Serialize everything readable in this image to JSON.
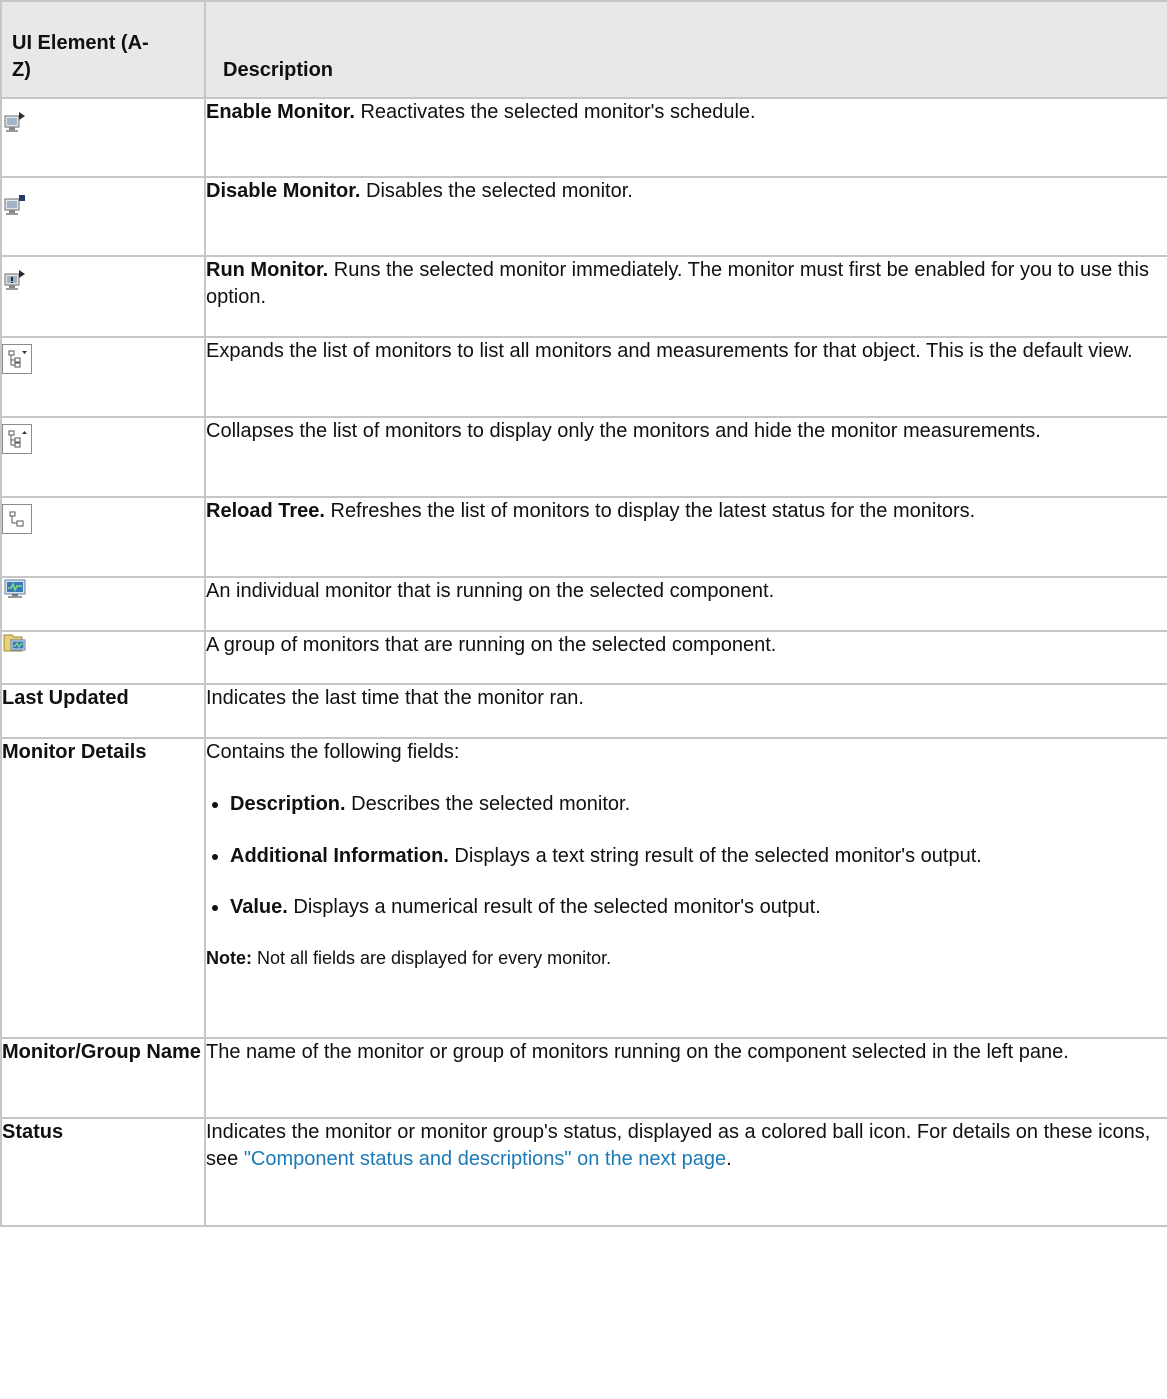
{
  "header": {
    "col1": "UI Element (A-Z)",
    "col2": "Description"
  },
  "rows": [
    {
      "icon": "enable-monitor-icon",
      "term": "Enable Monitor.",
      "text": " Reactivates the selected monitor's schedule."
    },
    {
      "icon": "disable-monitor-icon",
      "term": "Disable Monitor.",
      "text": " Disables the selected monitor."
    },
    {
      "icon": "run-monitor-icon",
      "term": "Run Monitor.",
      "text": " Runs the selected monitor immediately. The monitor must first be enabled for you to use this option."
    },
    {
      "icon": "expand-tree-icon",
      "term": "",
      "text": "Expands the list of monitors to list all monitors and measurements for that object. This is the default view."
    },
    {
      "icon": "collapse-tree-icon",
      "term": "",
      "text": "Collapses the list of monitors to display only the monitors and hide the monitor measurements."
    },
    {
      "icon": "reload-tree-icon",
      "term": "Reload Tree.",
      "text": " Refreshes the list of monitors to display the latest status for the monitors."
    },
    {
      "icon": "individual-monitor-icon",
      "term": "",
      "text": "An individual monitor that is running on the selected component."
    },
    {
      "icon": "monitor-group-icon",
      "term": "",
      "text": "A group of monitors that are running on the selected component."
    },
    {
      "label": "Last Updated",
      "text": "Indicates the last time that the monitor ran."
    },
    {
      "label": "Monitor Details",
      "intro": "Contains the following fields:",
      "fields": [
        {
          "term": "Description.",
          "text": " Describes the selected monitor."
        },
        {
          "term": "Additional Information.",
          "text": " Displays a text string result of the selected monitor's output."
        },
        {
          "term": "Value.",
          "text": " Displays a numerical result of the selected monitor's output."
        }
      ],
      "note_label": "Note:",
      "note_text": " Not all fields are displayed for every monitor."
    },
    {
      "label": "Monitor/Group Name",
      "text": "The name of the monitor or group of monitors running on the component selected in the left pane."
    },
    {
      "label": "Status",
      "text": "Indicates the monitor or monitor group's status, displayed as a colored ball icon. For details on these icons, see ",
      "link": "\"Component status and descriptions\" on the next page",
      "end": "."
    }
  ]
}
